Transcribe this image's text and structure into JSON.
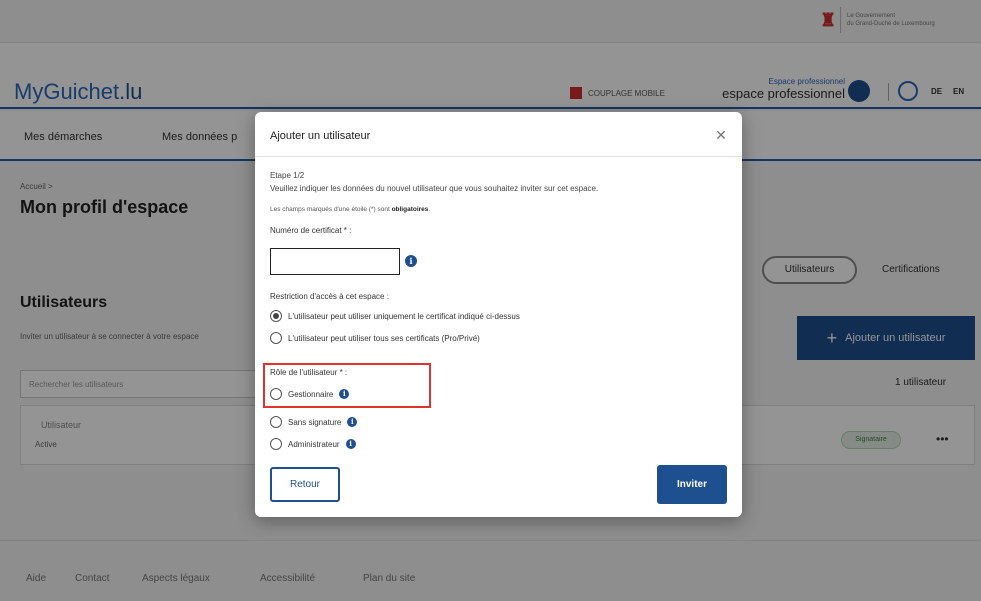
{
  "gov": {
    "line1": "Le Gouvernement",
    "line2": "du Grand-Duché de Luxembourg"
  },
  "header": {
    "brand_part1": "MyGuichet",
    "brand_part2": ".lu",
    "couple_label": "COUPLAGE MOBILE",
    "space_small": "Espace professionnel",
    "space_big": "espace professionnel",
    "lang_de": "DE",
    "lang_en": "EN"
  },
  "nav": {
    "item1": "Mes démarches",
    "item2": "Mes données p"
  },
  "breadcrumb": "Accueil >",
  "page_title": "Mon profil d'espace",
  "tabs": {
    "users": "Utilisateurs",
    "certs": "Certifications"
  },
  "section": {
    "title": "Utilisateurs",
    "desc": "Inviter un utilisateur à se connecter à votre espace",
    "add_button": "Ajouter un utilisateur",
    "search_placeholder": "Rechercher les utilisateurs",
    "count": "1 utilisateur"
  },
  "row": {
    "col1": "Utilisateur",
    "status": "Active",
    "badge": "Signataire",
    "more": "•••"
  },
  "footer": {
    "help": "Aide",
    "contact": "Contact",
    "legal": "Aspects légaux",
    "accessibility": "Accessibilité",
    "sitemap": "Plan du site"
  },
  "modal": {
    "title": "Ajouter un utilisateur",
    "close": "✕",
    "step": "Etape 1/2",
    "instruction": "Veuillez indiquer les données du nouvel utilisateur que vous souhaitez inviter sur cet espace.",
    "required_note": "Les champs marqués d'une étoile (*) sont ",
    "required_word": "obligatoires",
    "cert_label": "Numéro de certificat * :",
    "restriction_label": "Restriction d'accès à cet espace :",
    "restriction_options": [
      {
        "label": "L'utilisateur peut utiliser uniquement le certificat indiqué ci-dessus",
        "selected": true
      },
      {
        "label": "L'utilisateur peut utiliser tous ses certificats (Pro/Privé)",
        "selected": false
      }
    ],
    "role_label": "Rôle de l'utilisateur * :",
    "role_options": [
      {
        "label": "Gestionnaire",
        "selected": false
      },
      {
        "label": "Sans signature",
        "selected": false
      },
      {
        "label": "Administrateur",
        "selected": false
      }
    ],
    "back_button": "Retour",
    "invite_button": "Inviter"
  },
  "colors": {
    "primary": "#1e4f8e",
    "brand": "#2a68b8",
    "highlight": "#e0322e"
  },
  "icons": {
    "info": "info-icon",
    "close": "close-icon",
    "plus": "plus-icon",
    "user": "user-icon"
  }
}
